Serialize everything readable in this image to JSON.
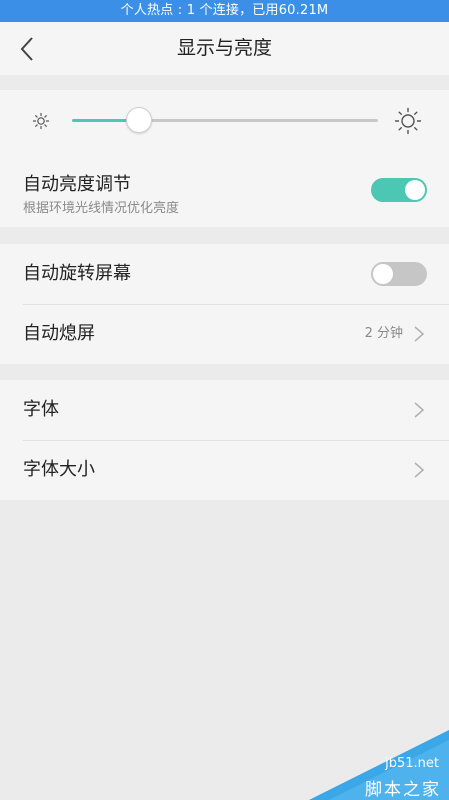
{
  "status_bar": {
    "text": "个人热点 : 1 个连接，已用60.21M"
  },
  "header": {
    "title": "显示与亮度",
    "back_icon": "chevron-left-icon"
  },
  "brightness": {
    "level_fraction": 0.22,
    "min_icon": "sun-small-icon",
    "max_icon": "sun-large-icon",
    "track_color": "#c8c8c8",
    "fill_color": "#4cc7b4"
  },
  "auto_brightness": {
    "title": "自动亮度调节",
    "subtitle": "根据环境光线情况优化亮度",
    "enabled": true
  },
  "auto_rotate": {
    "title": "自动旋转屏幕",
    "enabled": false
  },
  "screen_timeout": {
    "title": "自动熄屏",
    "value": "2 分钟"
  },
  "font": {
    "title": "字体"
  },
  "font_size": {
    "title": "字体大小"
  },
  "watermark": {
    "site": "jb51.net",
    "name": "脚本之家"
  },
  "colors": {
    "accent": "#4cc7b4",
    "status_bar": "#3b8fe6",
    "watermark": "#3aa7e8"
  }
}
